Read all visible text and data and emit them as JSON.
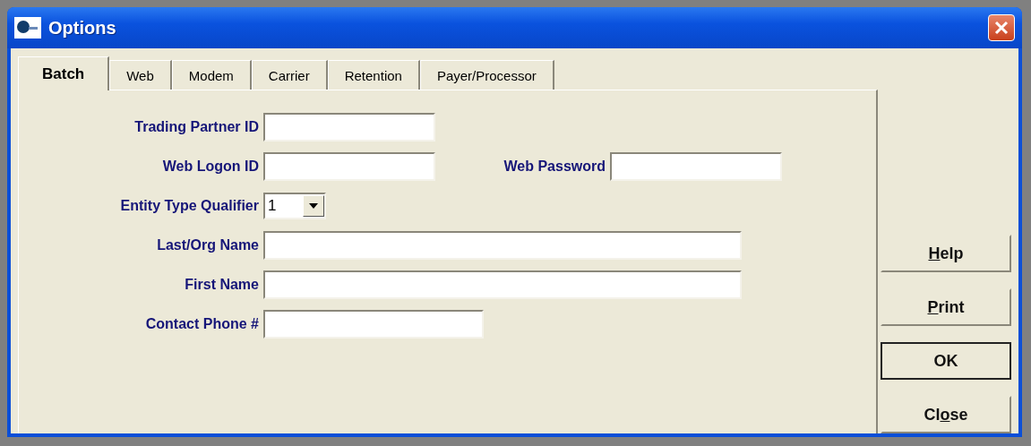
{
  "window": {
    "title": "Options"
  },
  "tabs": [
    {
      "label": "Batch",
      "selected": true
    },
    {
      "label": "Web",
      "selected": false
    },
    {
      "label": "Modem",
      "selected": false
    },
    {
      "label": "Carrier",
      "selected": false
    },
    {
      "label": "Retention",
      "selected": false
    },
    {
      "label": "Payer/Processor",
      "selected": false
    }
  ],
  "fields": [
    {
      "kind": "short",
      "label": "Trading Partner ID"
    },
    {
      "kind": "pair",
      "label": "Web Logon ID",
      "second_label": "Web Password"
    },
    {
      "kind": "select",
      "label": "Entity Type Qualifier",
      "value": "1"
    },
    {
      "kind": "long",
      "label": "Last/Org Name"
    },
    {
      "kind": "long",
      "label": "First Name"
    },
    {
      "kind": "phone",
      "label": "Contact Phone #"
    }
  ],
  "buttons": [
    {
      "key": "H",
      "after": "elp",
      "default": false
    },
    {
      "key": "P",
      "after": "rint",
      "default": false
    },
    {
      "before": "OK",
      "default": true
    },
    {
      "before": "Cl",
      "key": "o",
      "after": "se",
      "default": false
    }
  ]
}
